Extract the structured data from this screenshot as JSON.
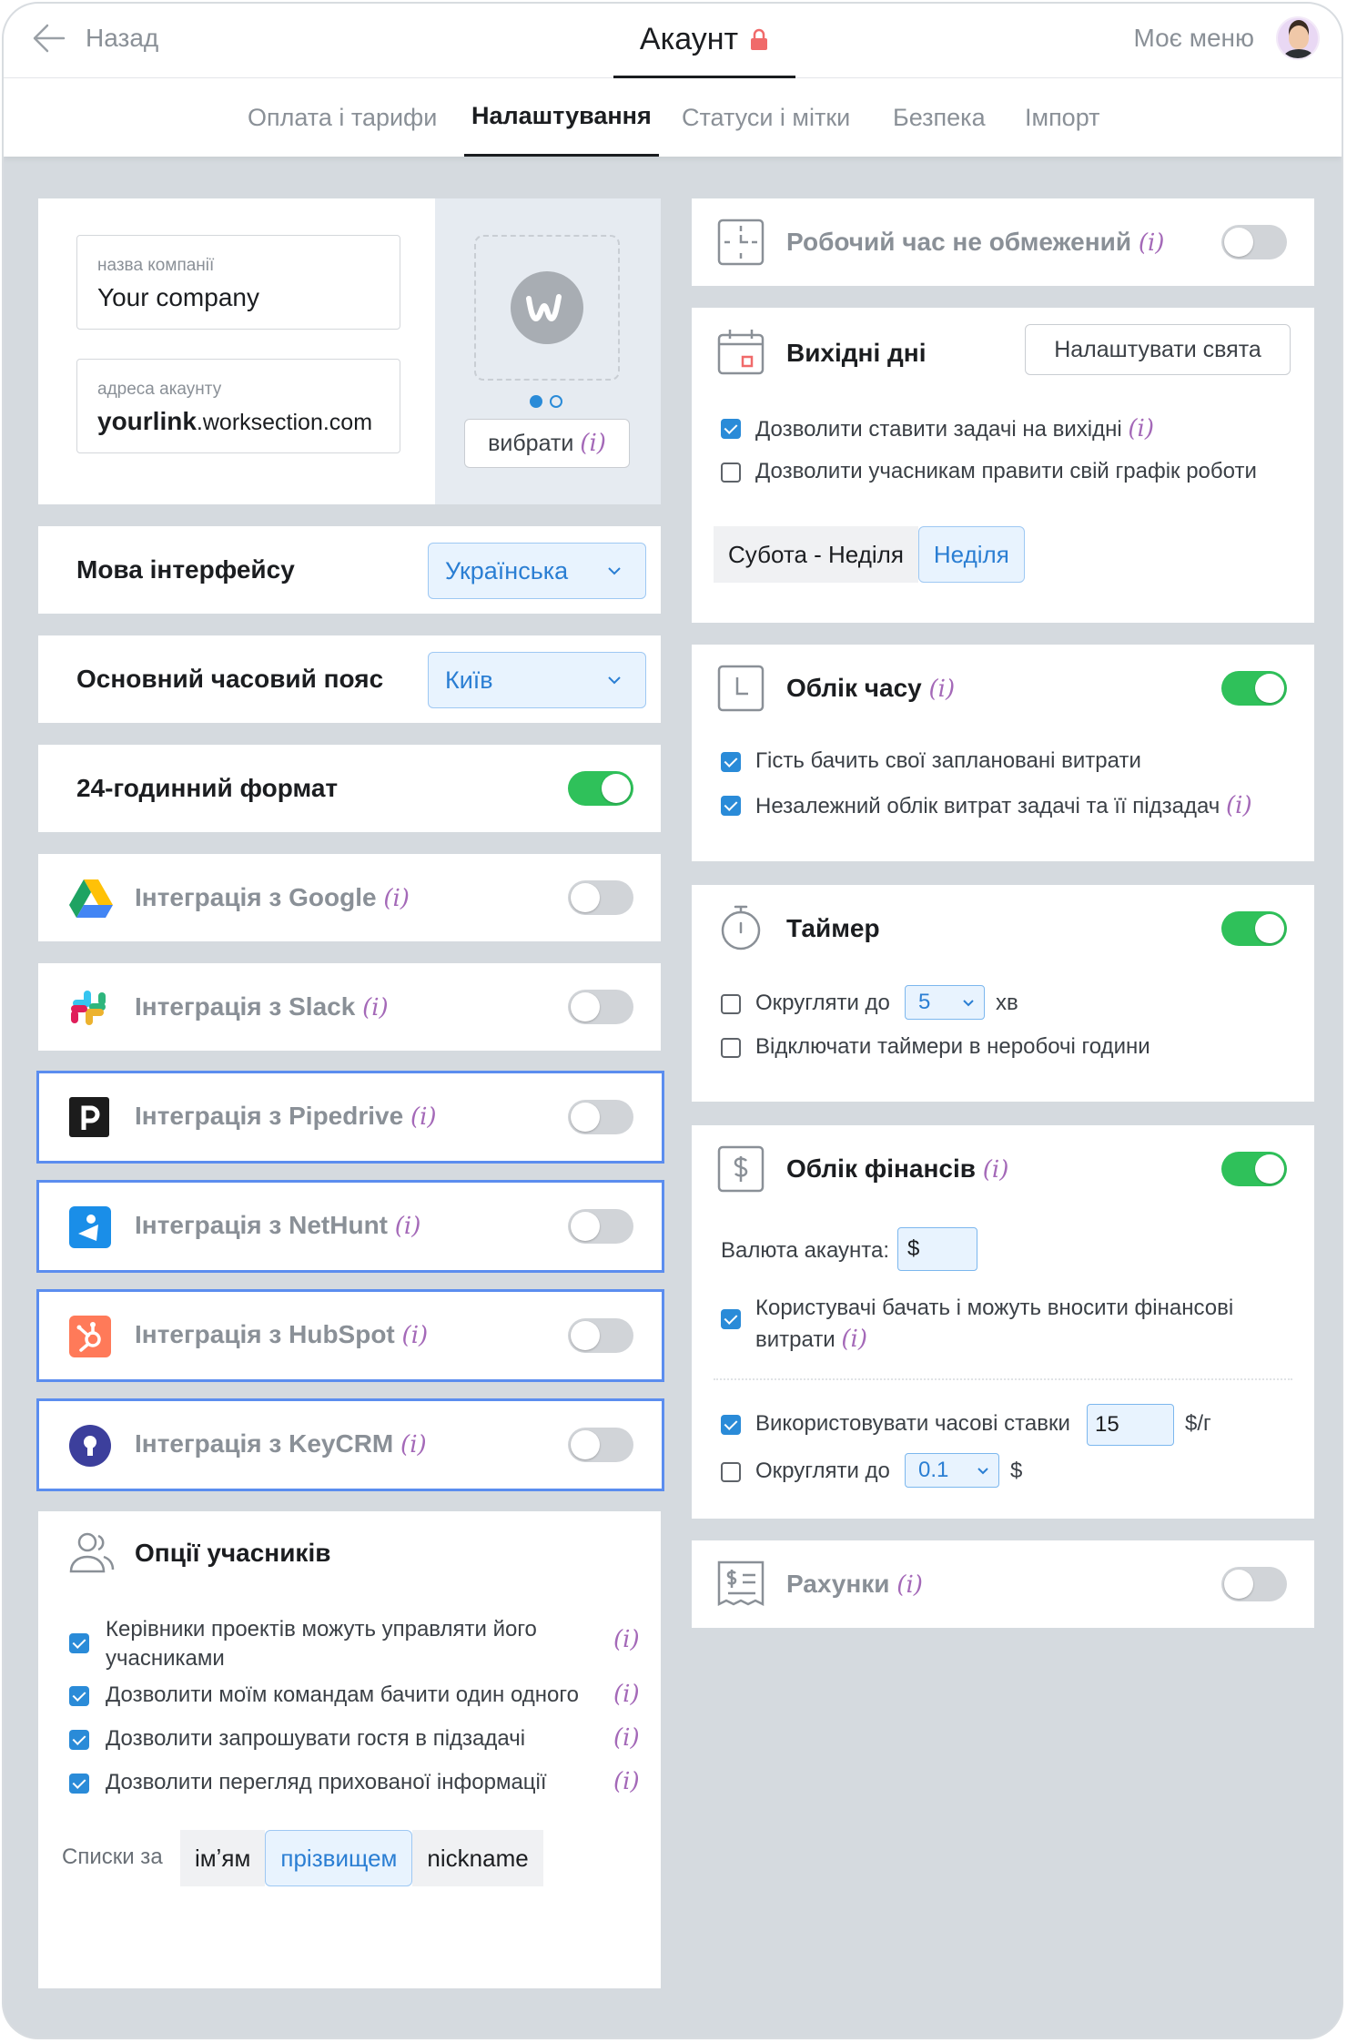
{
  "header": {
    "back_label": "Назад",
    "title": "Акаунт",
    "my_menu_label": "Моє меню"
  },
  "tabs": [
    {
      "label": "Оплата і тарифи",
      "active": false
    },
    {
      "label": "Налаштування",
      "active": true
    },
    {
      "label": "Статуси і мітки",
      "active": false
    },
    {
      "label": "Безпека",
      "active": false
    },
    {
      "label": "Імпорт",
      "active": false
    }
  ],
  "company": {
    "name_label": "назва компанії",
    "name_value": "Your company",
    "address_label": "адреса акаунту",
    "address_bold": "yourlink",
    "address_rest": ".worksection.com",
    "choose_label": "вибрати",
    "info": "(i)"
  },
  "language": {
    "label": "Мова інтерфейсу",
    "value": "Українська"
  },
  "timezone": {
    "label": "Основний часовий пояс",
    "value": "Київ"
  },
  "format24": {
    "label": "24-годинний формат",
    "on": true
  },
  "integrations": [
    {
      "label": "Інтеграція з Google",
      "icon": "google-drive-icon",
      "highlighted": false,
      "on": false
    },
    {
      "label": "Інтеграція з Slack",
      "icon": "slack-icon",
      "highlighted": false,
      "on": false
    },
    {
      "label": "Інтеграція з Pipedrive",
      "icon": "pipedrive-icon",
      "highlighted": true,
      "on": false
    },
    {
      "label": "Інтеграція з NetHunt",
      "icon": "nethunt-icon",
      "highlighted": true,
      "on": false
    },
    {
      "label": "Інтеграція з HubSpot",
      "icon": "hubspot-icon",
      "highlighted": true,
      "on": false
    },
    {
      "label": "Інтеграція з KeyCRM",
      "icon": "keycrm-icon",
      "highlighted": true,
      "on": false
    }
  ],
  "members": {
    "title": "Опції учасників",
    "options": [
      {
        "text": "Керівники проектів можуть управляти його учасниками",
        "checked": true
      },
      {
        "text": "Дозволити моїм командам бачити один одного",
        "checked": true
      },
      {
        "text": "Дозволити запрошувати гостя в підзадачі",
        "checked": true
      },
      {
        "text": "Дозволити перегляд прихованої інформації",
        "checked": true
      }
    ],
    "lists_label": "Списки за",
    "sort_options": [
      "імʼям",
      "прізвищем",
      "nickname"
    ],
    "sort_selected": "прізвищем"
  },
  "work_time": {
    "label": "Робочий час не обмежений",
    "on": false
  },
  "weekends": {
    "label": "Вихідні дні",
    "holidays_button": "Налаштувати свята",
    "options": [
      {
        "text": "Дозволити ставити задачі на вихідні",
        "checked": true,
        "info": true
      },
      {
        "text": "Дозволити учасникам правити свій графік роботи",
        "checked": false,
        "info": false
      }
    ],
    "day_options": [
      "Субота - Неділя",
      "Неділя"
    ],
    "day_selected": "Неділя"
  },
  "time_tracking": {
    "label": "Облік часу",
    "on": true,
    "options": [
      {
        "text": "Гість бачить свої заплановані витрати",
        "checked": true,
        "info": false
      },
      {
        "text": "Незалежний облік витрат задачі та її підзадач",
        "checked": true,
        "info": true
      }
    ]
  },
  "timer": {
    "label": "Таймер",
    "on": true,
    "round_label": "Округляти до",
    "round_value": "5",
    "round_unit": "хв",
    "round_checked": false,
    "disable_label": "Відключати таймери в неробочі години",
    "disable_checked": false
  },
  "finance": {
    "label": "Облік фінансів",
    "on": true,
    "currency_label": "Валюта акаунта:",
    "currency_value": "$",
    "users_text_1": "Користувачі бачать і можуть вносити фінансові",
    "users_text_2": "витрати",
    "users_checked": true,
    "rates_label": "Використовувати часові ставки",
    "rates_value": "15",
    "rates_unit": "$/г",
    "rates_checked": true,
    "round_label": "Округляти до",
    "round_value": "0.1",
    "round_unit": "$",
    "round_checked": false
  },
  "invoices": {
    "label": "Рахунки",
    "on": false
  },
  "colors": {
    "accent": "#2a8bd8",
    "toggle_on": "#2fc15a",
    "info": "#a469b8",
    "highlight": "#5b8def"
  }
}
